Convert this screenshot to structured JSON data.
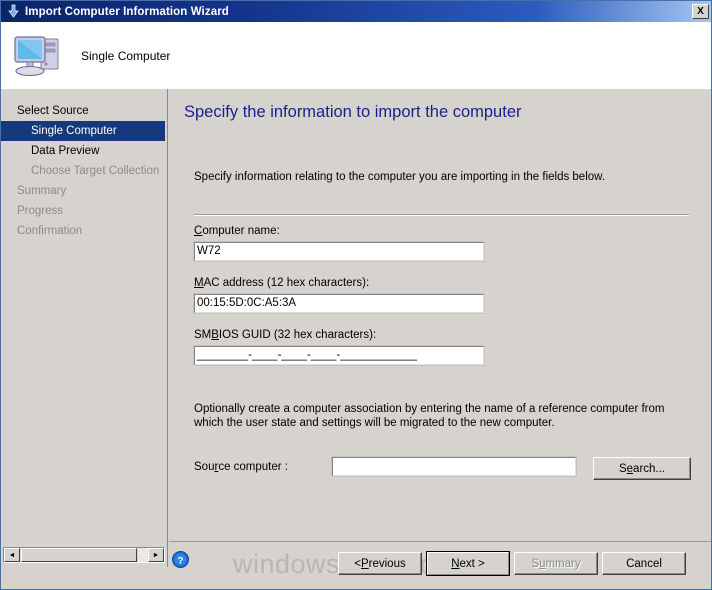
{
  "window": {
    "title": "Import Computer Information Wizard",
    "close_label": "X",
    "icon": "import-arrow-icon"
  },
  "header": {
    "title": "Single Computer",
    "icon": "computer-icon"
  },
  "sidebar": {
    "items": [
      {
        "label": "Select Source",
        "level": 0,
        "state": "normal"
      },
      {
        "label": "Single Computer",
        "level": 1,
        "state": "selected"
      },
      {
        "label": "Data Preview",
        "level": 1,
        "state": "normal"
      },
      {
        "label": "Choose Target Collection",
        "level": 1,
        "state": "disabled"
      },
      {
        "label": "Summary",
        "level": 0,
        "state": "disabled"
      },
      {
        "label": "Progress",
        "level": 0,
        "state": "disabled"
      },
      {
        "label": "Confirmation",
        "level": 0,
        "state": "disabled"
      }
    ],
    "scrollbar": {
      "left_arrow": "◄",
      "right_arrow": "►"
    }
  },
  "main": {
    "heading": "Specify the information to import the computer",
    "intro": "Specify information relating to the computer you are importing in the fields below.",
    "fields": {
      "computer_name": {
        "label_pre": "",
        "label_accel": "C",
        "label_post": "omputer name:",
        "value": "W72",
        "placeholder": ""
      },
      "mac_address": {
        "label_pre": "",
        "label_accel": "M",
        "label_post": "AC address (12 hex characters):",
        "value": "00:15:5D:0C:A5:3A",
        "placeholder": ""
      },
      "smbios_guid": {
        "label_pre": "SM",
        "label_accel": "B",
        "label_post": "IOS GUID (32 hex characters):",
        "value": "________-____-____-____-____________",
        "placeholder": ""
      },
      "source_computer": {
        "label_pre": "Sou",
        "label_accel": "r",
        "label_post": "ce computer :",
        "value": "",
        "placeholder": ""
      }
    },
    "optional_text": "Optionally create a computer association by entering the name of a reference computer from which the user state and settings will be migrated to the new computer.",
    "search_button": {
      "pre": "S",
      "accel": "e",
      "post": "arch..."
    }
  },
  "footer": {
    "help_icon": "help-question-icon",
    "buttons": [
      {
        "name": "previous",
        "pre": "< ",
        "accel": "P",
        "post": "revious",
        "state": "enabled",
        "default": false
      },
      {
        "name": "next",
        "pre": "",
        "accel": "N",
        "post": "ext >",
        "state": "enabled",
        "default": true
      },
      {
        "name": "summary",
        "pre": "S",
        "accel": "u",
        "post": "mmary",
        "state": "disabled",
        "default": false
      },
      {
        "name": "cancel",
        "pre": "Cancel",
        "accel": "",
        "post": "",
        "state": "enabled",
        "default": false
      }
    ]
  },
  "watermark": {
    "text": "windows-noob.com"
  },
  "colors": {
    "titlebar_start": "#0a246a",
    "titlebar_end": "#a6c8f0",
    "face": "#d6d3ce",
    "selection": "#16387c",
    "heading": "#1b1f8c",
    "disabled_text": "#8a8a86",
    "watermark": "#b9b6b1"
  }
}
